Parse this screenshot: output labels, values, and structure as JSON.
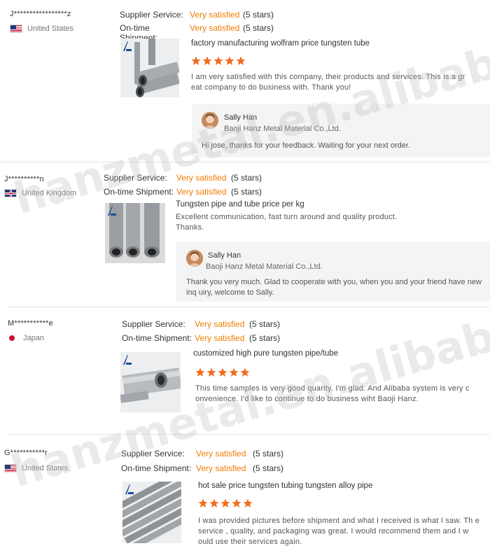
{
  "labels": {
    "supplier_service": "Supplier Service:",
    "ontime_shipment": "On-time Shipment:"
  },
  "watermark": "hanzmetal.en.alibaba.com",
  "colors": {
    "accent": "#f07c00",
    "star": "#f26c1d",
    "reply_bg": "#f4f4f4"
  },
  "reviews": [
    {
      "buyer": "J*****************z",
      "country": "United States",
      "flag": "us-flag-icon",
      "supplier_service": "Very satisfied",
      "supplier_stars": "(5 stars)",
      "shipment": "Very satisfied",
      "shipment_stars": "(5 stars)",
      "product_title": "factory manufacturing wolfram price tungsten tube",
      "rating": 5,
      "comment": "I am very satisfied with this company, their products and services. This is a gr eat company to do business with. Thank you!",
      "reply": {
        "name": "Sally Han",
        "company": "Baoji Hanz Metal Material Co.,Ltd.",
        "text": "Hi jose, thanks for your feedback. Waiting for your next order."
      }
    },
    {
      "buyer": "J**********n",
      "country": "United Kingdom",
      "flag": "uk-flag-icon",
      "supplier_service": "Very satisfied",
      "supplier_stars": "(5 stars)",
      "shipment": "Very satisfied",
      "shipment_stars": "(5 stars)",
      "product_title": "Tungsten pipe and tube price per kg",
      "comment_line1": "Excellent communication, fast turn around and quality product.",
      "comment_line2": "Thanks.",
      "reply": {
        "name": "Sally Han",
        "company": "Baoji Hanz Metal Material Co.,Ltd.",
        "text": "Thank you very much. Glad to cooperate with you, when you and your friend have new inq uiry, welcome to Sally."
      }
    },
    {
      "buyer": "M***********e",
      "country": "Japan",
      "flag": "japan-flag-icon",
      "supplier_service": "Very satisfied",
      "supplier_stars": "(5 stars)",
      "shipment": "Very satisfied",
      "shipment_stars": "(5 stars)",
      "product_title": "customized high pure tungsten pipe/tube",
      "rating": 5,
      "comment": "This time samples is very good quarity. I'm glad. And Alibaba system is very c onvenience. I'd like to continue to do business wiht Baoji Hanz."
    },
    {
      "buyer": "G***********r",
      "country": "United States",
      "flag": "us-flag-icon",
      "supplier_service": "Very satisfied",
      "supplier_stars": "(5 stars)",
      "shipment": "Very satisfied",
      "shipment_stars": "(5 stars)",
      "product_title": "hot sale price tungsten tubing tungsten alloy pipe",
      "rating": 5,
      "comment": "I was provided pictures before shipment and what I received is what I saw. Th e service , quality, and packaging was great. I would recommend them and I w ould use their services again."
    }
  ]
}
